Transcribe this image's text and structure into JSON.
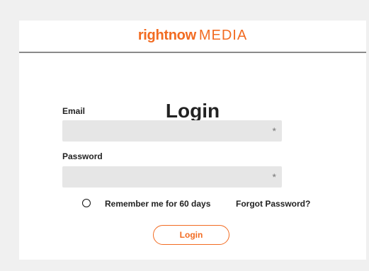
{
  "header": {
    "logo_primary": "rightnow",
    "logo_secondary": "MEDIA",
    "brand_color": "#f26b21"
  },
  "form": {
    "title": "Login",
    "email_label": "Email",
    "email_value": "",
    "email_required_marker": "*",
    "password_label": "Password",
    "password_value": "",
    "password_required_marker": "*",
    "remember_label": "Remember me for 60 days",
    "remember_checked": false,
    "forgot_label": "Forgot Password?",
    "submit_label": "Login"
  }
}
